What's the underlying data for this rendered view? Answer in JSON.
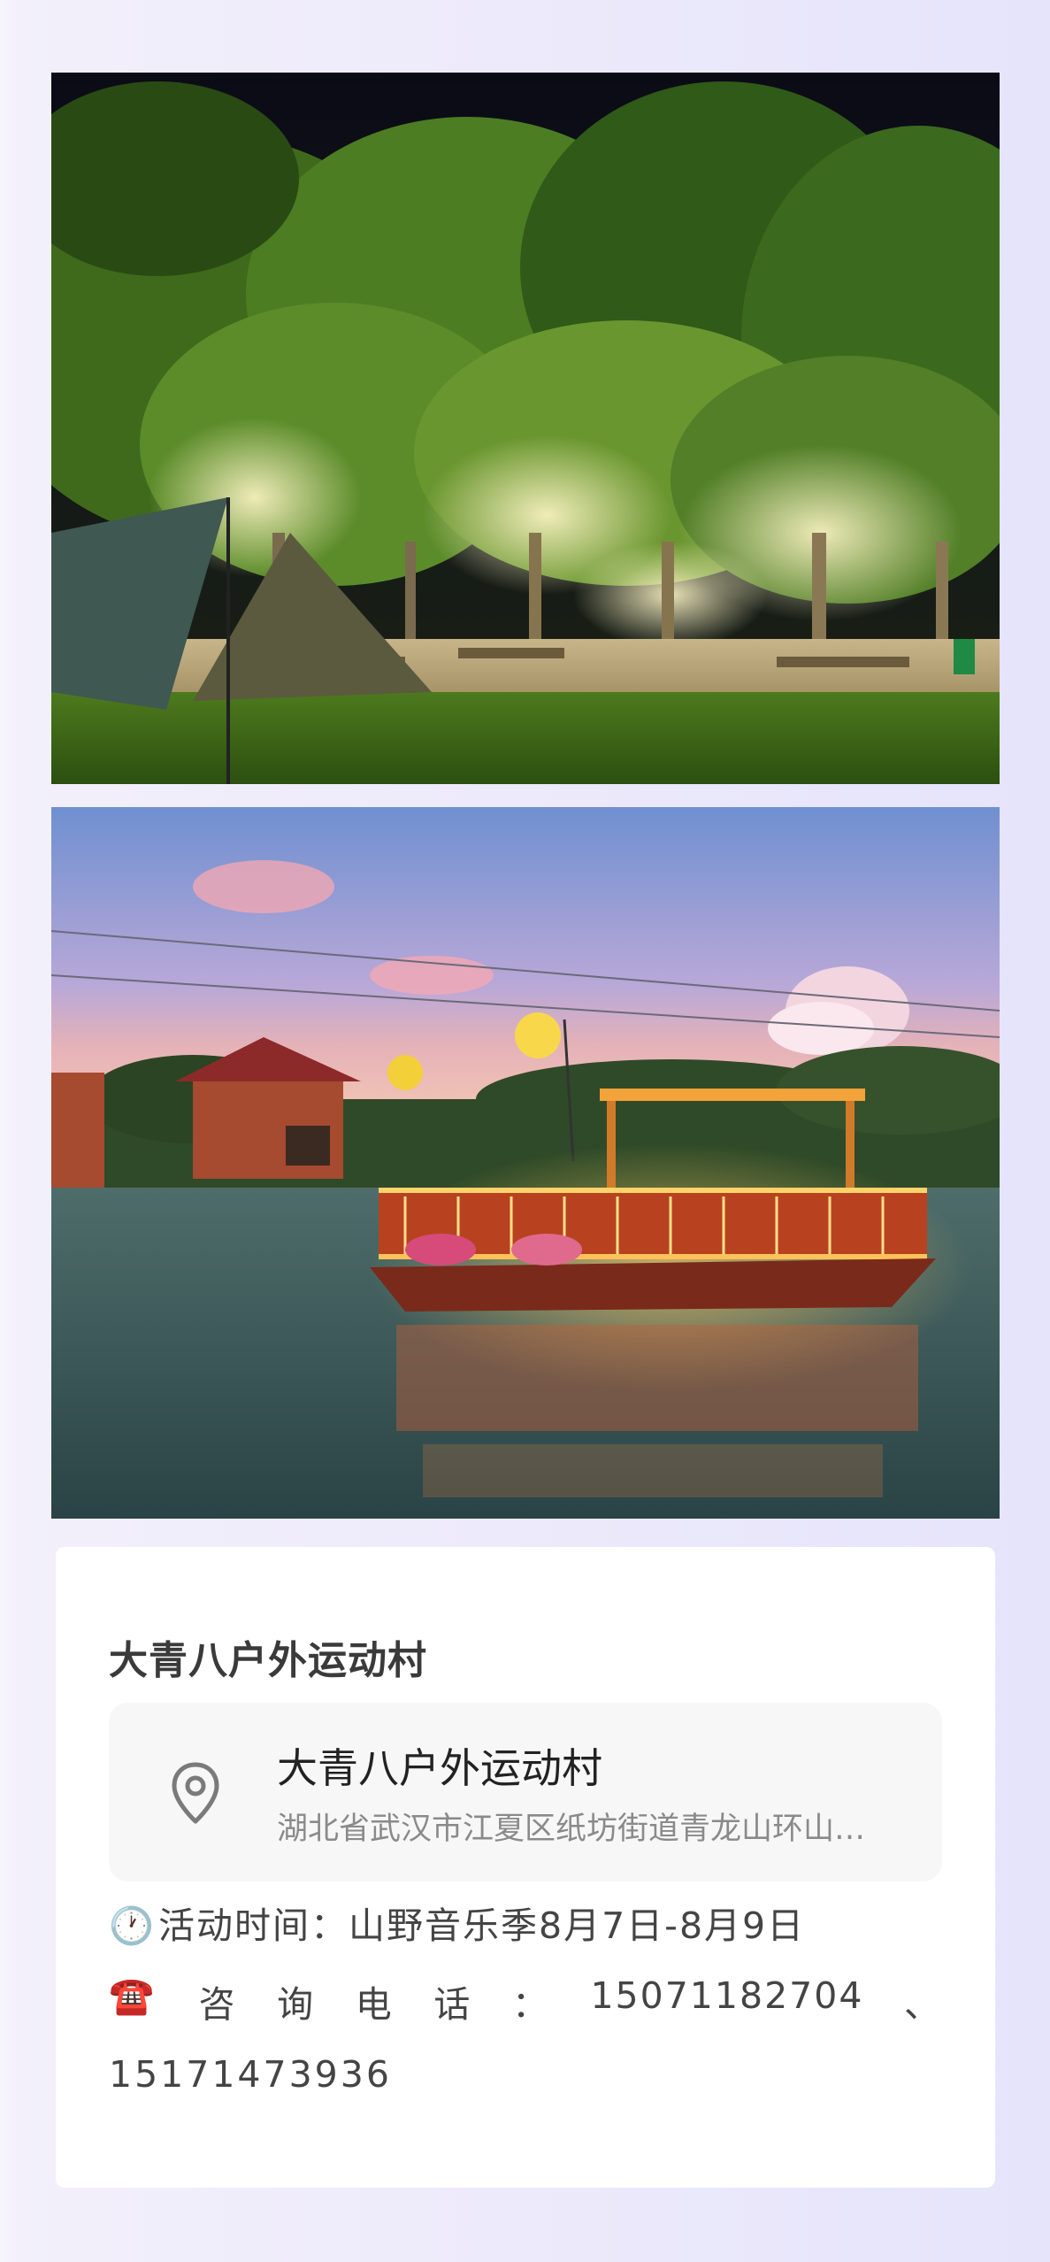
{
  "photos": [
    {
      "description_name": "campsite-night-photo"
    },
    {
      "description_name": "lake-boat-sunset-photo"
    }
  ],
  "venue": {
    "title": "大青八户外运动村",
    "location_name": "大青八户外运动村",
    "location_address": "湖北省武汉市江夏区纸坊街道青龙山环山…",
    "location_icon": "map-pin-icon"
  },
  "info": {
    "time_icon": "🕐",
    "time_text": "活动时间：山野音乐季8月7日-8月9日",
    "phone_icon": "☎️",
    "phone_label_chars": [
      "咨",
      "询",
      "电",
      "话",
      "："
    ],
    "phone_number_1": "15071182704",
    "phone_separator": "、",
    "phone_number_2": "15171473936"
  },
  "colors": {
    "background": "#ece9fb",
    "card": "#ffffff",
    "title": "#3a3a3a",
    "address": "#8a8a8a"
  }
}
